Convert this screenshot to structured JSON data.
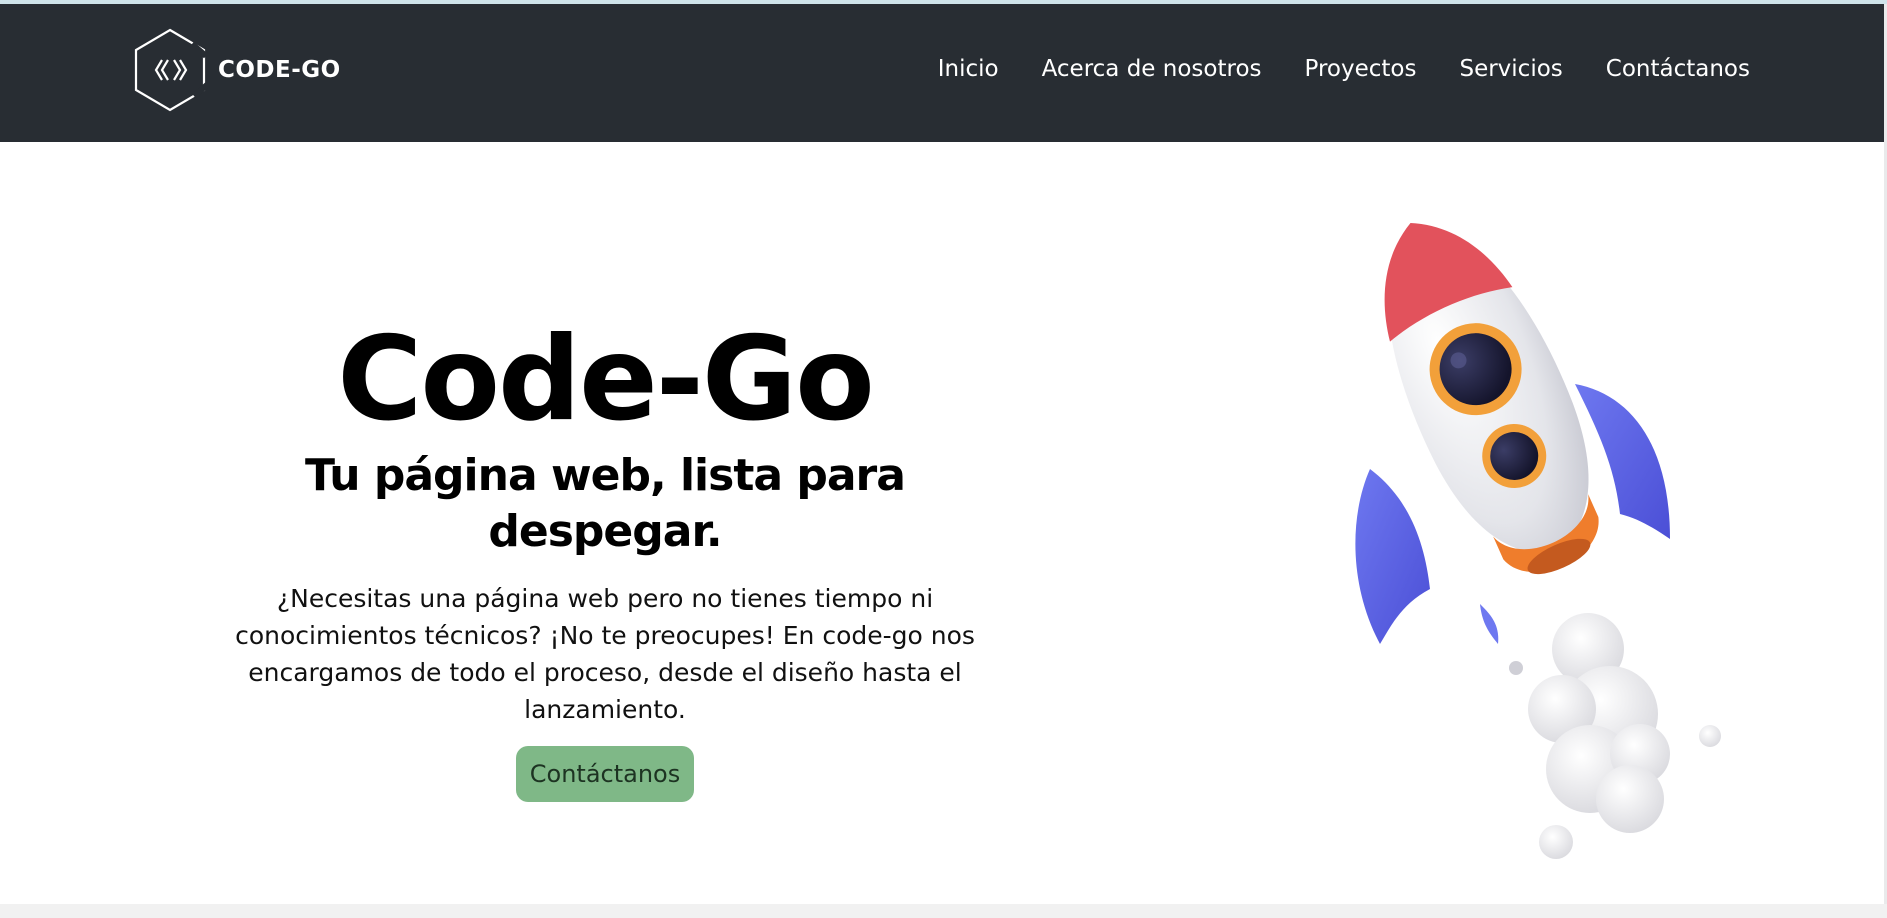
{
  "navbar": {
    "brand": {
      "name": "CODE-GO",
      "logo_icon": "hexagon-code-icon"
    },
    "links": [
      {
        "label": "Inicio"
      },
      {
        "label": "Acerca de nosotros"
      },
      {
        "label": "Proyectos"
      },
      {
        "label": "Servicios"
      },
      {
        "label": "Contáctanos"
      }
    ]
  },
  "hero": {
    "title": "Code-Go",
    "subtitle": "Tu página web, lista para despegar.",
    "description": "¿Necesitas una página web pero no tienes tiempo ni conocimientos técnicos? ¡No te preocupes! En code-go nos encargamos de todo el proceso, desde el diseño hasta el lanzamiento.",
    "cta_label": "Contáctanos",
    "illustration": "rocket-illustration"
  },
  "colors": {
    "navbar_bg": "#282d33",
    "cta_bg": "#7fb887",
    "rocket_nose": "#e2525c",
    "rocket_fins": "#5a63e6",
    "rocket_ring": "#f2a03a",
    "rocket_nozzle": "#ef7d2c"
  }
}
